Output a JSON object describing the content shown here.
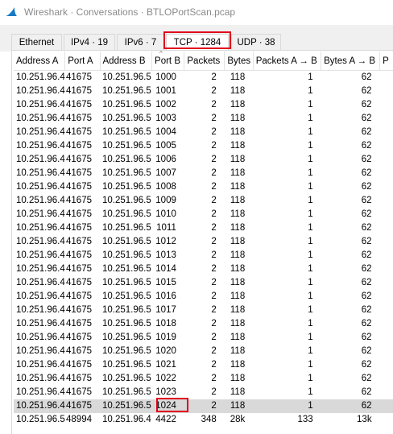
{
  "window": {
    "title": "Wireshark · Conversations · BTLOPortScan.pcap",
    "icon": "wireshark-fin-icon"
  },
  "tabs": [
    {
      "label": "Ethernet",
      "active": false
    },
    {
      "label": "IPv4 · 19",
      "active": false
    },
    {
      "label": "IPv6 · 7",
      "active": false
    },
    {
      "label": "TCP · 1284",
      "active": true
    },
    {
      "label": "UDP · 38",
      "active": false
    }
  ],
  "colors": {
    "highlight": "#e0001b",
    "selected_row": "#d9d9d9"
  },
  "columns": [
    "Address A",
    "Port A",
    "Address B",
    "Port B",
    "Packets",
    "Bytes",
    "Packets A → B",
    "Bytes A → B",
    "P"
  ],
  "rows": [
    [
      "10.251.96.4",
      "41675",
      "10.251.96.5",
      "1000",
      "2",
      "118",
      "1",
      "62"
    ],
    [
      "10.251.96.4",
      "41675",
      "10.251.96.5",
      "1001",
      "2",
      "118",
      "1",
      "62"
    ],
    [
      "10.251.96.4",
      "41675",
      "10.251.96.5",
      "1002",
      "2",
      "118",
      "1",
      "62"
    ],
    [
      "10.251.96.4",
      "41675",
      "10.251.96.5",
      "1003",
      "2",
      "118",
      "1",
      "62"
    ],
    [
      "10.251.96.4",
      "41675",
      "10.251.96.5",
      "1004",
      "2",
      "118",
      "1",
      "62"
    ],
    [
      "10.251.96.4",
      "41675",
      "10.251.96.5",
      "1005",
      "2",
      "118",
      "1",
      "62"
    ],
    [
      "10.251.96.4",
      "41675",
      "10.251.96.5",
      "1006",
      "2",
      "118",
      "1",
      "62"
    ],
    [
      "10.251.96.4",
      "41675",
      "10.251.96.5",
      "1007",
      "2",
      "118",
      "1",
      "62"
    ],
    [
      "10.251.96.4",
      "41675",
      "10.251.96.5",
      "1008",
      "2",
      "118",
      "1",
      "62"
    ],
    [
      "10.251.96.4",
      "41675",
      "10.251.96.5",
      "1009",
      "2",
      "118",
      "1",
      "62"
    ],
    [
      "10.251.96.4",
      "41675",
      "10.251.96.5",
      "1010",
      "2",
      "118",
      "1",
      "62"
    ],
    [
      "10.251.96.4",
      "41675",
      "10.251.96.5",
      "1011",
      "2",
      "118",
      "1",
      "62"
    ],
    [
      "10.251.96.4",
      "41675",
      "10.251.96.5",
      "1012",
      "2",
      "118",
      "1",
      "62"
    ],
    [
      "10.251.96.4",
      "41675",
      "10.251.96.5",
      "1013",
      "2",
      "118",
      "1",
      "62"
    ],
    [
      "10.251.96.4",
      "41675",
      "10.251.96.5",
      "1014",
      "2",
      "118",
      "1",
      "62"
    ],
    [
      "10.251.96.4",
      "41675",
      "10.251.96.5",
      "1015",
      "2",
      "118",
      "1",
      "62"
    ],
    [
      "10.251.96.4",
      "41675",
      "10.251.96.5",
      "1016",
      "2",
      "118",
      "1",
      "62"
    ],
    [
      "10.251.96.4",
      "41675",
      "10.251.96.5",
      "1017",
      "2",
      "118",
      "1",
      "62"
    ],
    [
      "10.251.96.4",
      "41675",
      "10.251.96.5",
      "1018",
      "2",
      "118",
      "1",
      "62"
    ],
    [
      "10.251.96.4",
      "41675",
      "10.251.96.5",
      "1019",
      "2",
      "118",
      "1",
      "62"
    ],
    [
      "10.251.96.4",
      "41675",
      "10.251.96.5",
      "1020",
      "2",
      "118",
      "1",
      "62"
    ],
    [
      "10.251.96.4",
      "41675",
      "10.251.96.5",
      "1021",
      "2",
      "118",
      "1",
      "62"
    ],
    [
      "10.251.96.4",
      "41675",
      "10.251.96.5",
      "1022",
      "2",
      "118",
      "1",
      "62"
    ],
    [
      "10.251.96.4",
      "41675",
      "10.251.96.5",
      "1023",
      "2",
      "118",
      "1",
      "62"
    ],
    [
      "10.251.96.4",
      "41675",
      "10.251.96.5",
      "1024",
      "2",
      "118",
      "1",
      "62"
    ],
    [
      "10.251.96.5",
      "48994",
      "10.251.96.4",
      "4422",
      "348",
      "28k",
      "133",
      "13k"
    ]
  ],
  "selected_row_index": 24,
  "sort_indicator_icon": "sort-caret-up-icon"
}
